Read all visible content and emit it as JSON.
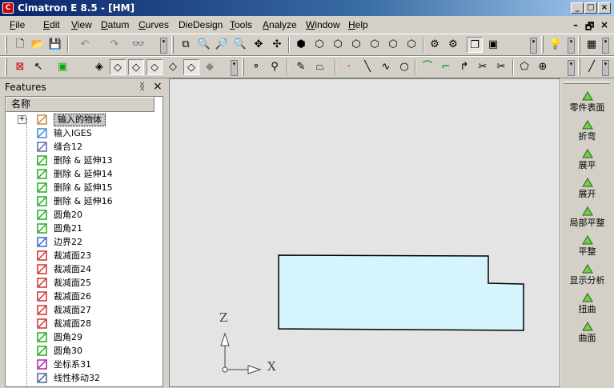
{
  "title": "Cimatron E 8.5 - [HM]",
  "window_controls": [
    "_",
    "□",
    "×"
  ],
  "menus": [
    "File",
    "Edit",
    "View",
    "Datum",
    "Curves",
    "DieDesign",
    "Tools",
    "Analyze",
    "Window",
    "Help"
  ],
  "menu_accel": [
    "F",
    "E",
    "V",
    "D",
    "C",
    "",
    "T",
    "A",
    "W",
    "H"
  ],
  "menu_rest": [
    "ile",
    "dit",
    "iew",
    "atum",
    "urves",
    "DieDesign",
    "ools",
    "nalyze",
    "indow",
    "elp"
  ],
  "mdi_controls": [
    "–",
    "🗗",
    "×"
  ],
  "panel": {
    "title": "Features",
    "pin": "ᛝ",
    "close": "×",
    "column_header": "名称"
  },
  "tree": [
    {
      "label": "输入的物体",
      "icon": "import-object-icon",
      "expand": "+"
    },
    {
      "label": "输入IGES",
      "icon": "import-iges-icon"
    },
    {
      "label": "缝合12",
      "icon": "stitch-icon"
    },
    {
      "label": "删除 & 延伸13",
      "icon": "delete-extend-icon"
    },
    {
      "label": "删除 & 延伸14",
      "icon": "delete-extend-icon"
    },
    {
      "label": "删除 & 延伸15",
      "icon": "delete-extend-icon"
    },
    {
      "label": "删除 & 延伸16",
      "icon": "delete-extend-icon"
    },
    {
      "label": "圆角20",
      "icon": "fillet-icon"
    },
    {
      "label": "圆角21",
      "icon": "fillet-icon"
    },
    {
      "label": "边界22",
      "icon": "boundary-icon"
    },
    {
      "label": "裁减面23",
      "icon": "trim-face-icon"
    },
    {
      "label": "裁减面24",
      "icon": "trim-face-icon"
    },
    {
      "label": "裁减面25",
      "icon": "trim-face-icon"
    },
    {
      "label": "裁减面26",
      "icon": "trim-face-icon"
    },
    {
      "label": "裁减面27",
      "icon": "trim-face-icon"
    },
    {
      "label": "裁减面28",
      "icon": "trim-face-icon"
    },
    {
      "label": "圆角29",
      "icon": "fillet-icon"
    },
    {
      "label": "圆角30",
      "icon": "fillet-icon"
    },
    {
      "label": "坐标系31",
      "icon": "ucs-icon"
    },
    {
      "label": "线性移动32",
      "icon": "linear-move-icon"
    }
  ],
  "axes": {
    "z": "Z",
    "x": "X"
  },
  "right_tools": [
    {
      "label": "零件表面",
      "icon": "part-surface-icon"
    },
    {
      "label": "折弯",
      "icon": "bend-icon"
    },
    {
      "label": "展平",
      "icon": "flatten-icon"
    },
    {
      "label": "展开",
      "icon": "unfold-icon"
    },
    {
      "label": "局部平整",
      "icon": "local-flatten-icon"
    },
    {
      "label": "平整",
      "icon": "smooth-icon"
    },
    {
      "label": "显示分析",
      "icon": "display-analysis-icon"
    },
    {
      "label": "扭曲",
      "icon": "twist-icon"
    },
    {
      "label": "曲面",
      "icon": "surface-icon"
    }
  ],
  "colors": {
    "title_start": "#0a246a",
    "part_fill": "#d6f4fb",
    "canvas_bg": "#e4e4e4",
    "selection": "#c8c8c8"
  }
}
